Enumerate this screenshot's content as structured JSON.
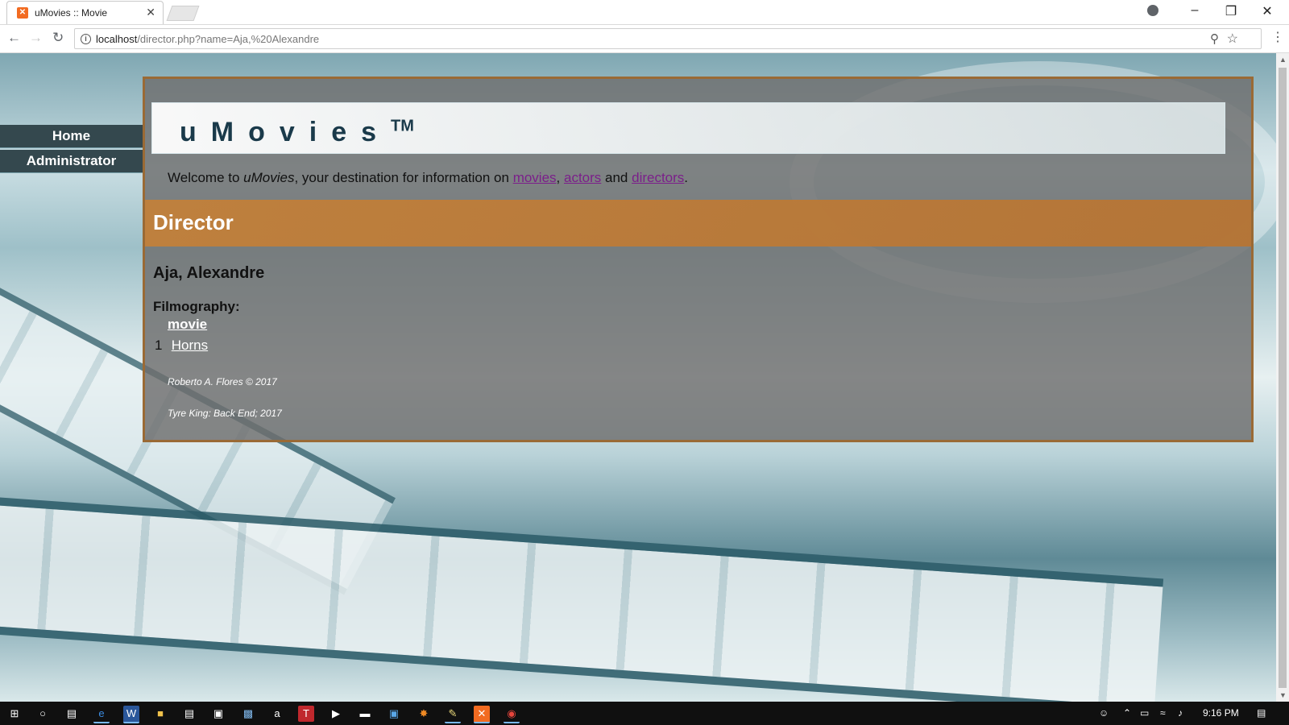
{
  "browser": {
    "tab_title": "uMovies :: Movie",
    "url_host": "localhost",
    "url_path": "/director.php?name=Aja,%20Alexandre"
  },
  "nav": {
    "items": [
      {
        "label": "Home"
      },
      {
        "label": "Administrator"
      }
    ]
  },
  "site": {
    "logo_text": "uMovies",
    "logo_tm": "TM",
    "welcome_prefix": "Welcome to ",
    "welcome_brand": "uMovies",
    "welcome_mid": ", your destination for information on ",
    "link_movies": "movies",
    "sep_comma": ", ",
    "link_actors": "actors",
    "sep_and": " and ",
    "link_directors": "directors",
    "welcome_end": "."
  },
  "page": {
    "section_title": "Director",
    "director_name": "Aja, Alexandre",
    "filmography_label": "Filmography:",
    "table_header": "movie",
    "films": [
      {
        "num": "1",
        "title": "Horns"
      }
    ],
    "credit_1": "Roberto A. Flores © 2017",
    "credit_2": "Tyre King: Back End; 2017"
  },
  "taskbar": {
    "clock": "9:16 PM"
  },
  "colors": {
    "panel_border": "#9a6a35",
    "section_bar": "#c48038",
    "nav_bg": "#34484e",
    "link": "#7b1f8a"
  }
}
